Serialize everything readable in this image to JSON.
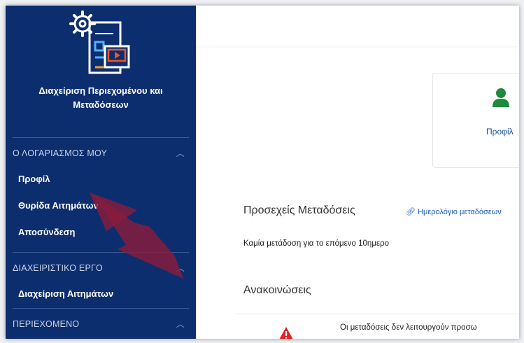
{
  "app": {
    "title_line1": "Διαχείριση Περιεχομένου και",
    "title_line2": "Μεταδόσεων"
  },
  "sidebar": {
    "sections": [
      {
        "label": "Ο ΛΟΓΑΡΙΑΣΜΟΣ ΜΟΥ",
        "items": [
          "Προφίλ",
          "Θυρίδα Αιτημάτων",
          "Αποσύνδεση"
        ]
      },
      {
        "label": "ΔΙΑΧΕΙΡΙΣΤΙΚΟ ΕΡΓΟ",
        "items": [
          "Διαχείριση Αιτημάτων"
        ]
      },
      {
        "label": "ΠΕΡΙΕΧΟΜΕΝΟ",
        "items": []
      }
    ]
  },
  "main": {
    "profile_card_label": "Προφίλ",
    "upcoming": {
      "title": "Προσεχείς Μεταδόσεις",
      "calendar_link": "Ημερολόγιο μεταδόσεων",
      "empty_text": "Καμία μετάδοση για το επόμενο 10ημερο"
    },
    "announcements": {
      "title": "Ανακοινώσεις",
      "first_text": "Οι μεταδόσεις δεν λειτουργούν προσω"
    }
  },
  "colors": {
    "sidebar_bg": "#0d2e6e",
    "profile_icon": "#1e8a3c",
    "link": "#1a5bbf",
    "arrow": "#8a1c3c",
    "warning": "#e0241f"
  }
}
